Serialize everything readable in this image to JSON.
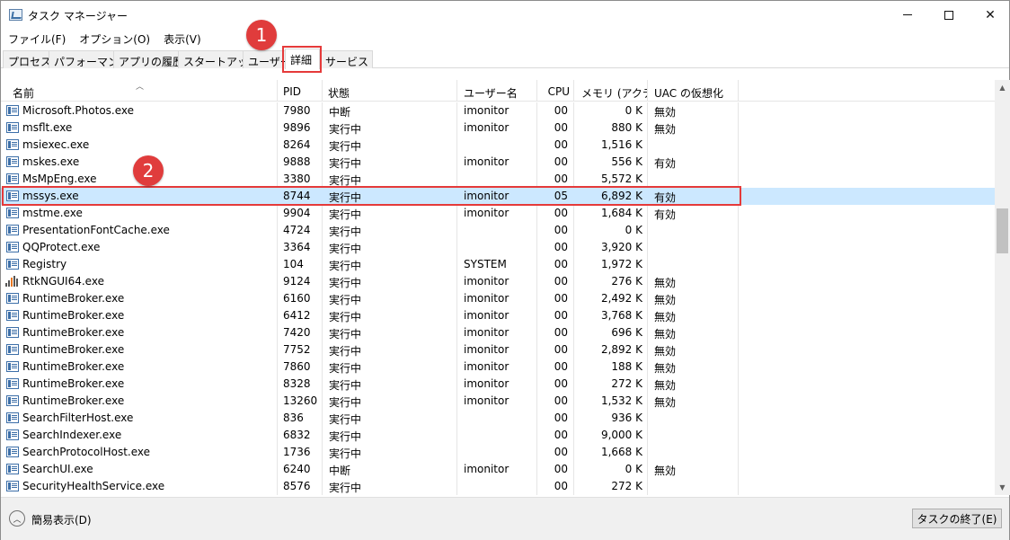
{
  "window": {
    "title": "タスク マネージャー",
    "accent_color": "#e03c3c",
    "selection_color": "#cce8ff"
  },
  "menu": [
    "ファイル(F)",
    "オプション(O)",
    "表示(V)"
  ],
  "tabs": [
    "プロセス",
    "パフォーマンス",
    "アプリの履歴",
    "スタートアップ",
    "ユーザー",
    "詳細",
    "サービス"
  ],
  "active_tab": "詳細",
  "badges": {
    "one": "1",
    "two": "2"
  },
  "columns": {
    "name": "名前",
    "pid": "PID",
    "status": "状態",
    "user": "ユーザー名",
    "cpu": "CPU",
    "memory": "メモリ (アクテ...",
    "uac": "UAC の仮想化"
  },
  "rows": [
    {
      "name": "Microsoft.Photos.exe",
      "pid": "7980",
      "status": "中断",
      "user": "imonitor",
      "cpu": "00",
      "memory": "0 K",
      "uac": "無効",
      "icon": "app-icon"
    },
    {
      "name": "msflt.exe",
      "pid": "9896",
      "status": "実行中",
      "user": "imonitor",
      "cpu": "00",
      "memory": "880 K",
      "uac": "無効",
      "icon": "app-icon"
    },
    {
      "name": "msiexec.exe",
      "pid": "8264",
      "status": "実行中",
      "user": "",
      "cpu": "00",
      "memory": "1,516 K",
      "uac": "",
      "icon": "app-icon"
    },
    {
      "name": "mskes.exe",
      "pid": "9888",
      "status": "実行中",
      "user": "imonitor",
      "cpu": "00",
      "memory": "556 K",
      "uac": "有効",
      "icon": "app-icon"
    },
    {
      "name": "MsMpEng.exe",
      "pid": "3380",
      "status": "実行中",
      "user": "",
      "cpu": "00",
      "memory": "5,572 K",
      "uac": "",
      "icon": "app-icon"
    },
    {
      "name": "mssys.exe",
      "pid": "8744",
      "status": "実行中",
      "user": "imonitor",
      "cpu": "05",
      "memory": "6,892 K",
      "uac": "有効",
      "icon": "app-icon",
      "selected": true
    },
    {
      "name": "mstme.exe",
      "pid": "9904",
      "status": "実行中",
      "user": "imonitor",
      "cpu": "00",
      "memory": "1,684 K",
      "uac": "有効",
      "icon": "app-icon"
    },
    {
      "name": "PresentationFontCache.exe",
      "pid": "4724",
      "status": "実行中",
      "user": "",
      "cpu": "00",
      "memory": "0 K",
      "uac": "",
      "icon": "app-icon"
    },
    {
      "name": "QQProtect.exe",
      "pid": "3364",
      "status": "実行中",
      "user": "",
      "cpu": "00",
      "memory": "3,920 K",
      "uac": "",
      "icon": "app-icon"
    },
    {
      "name": "Registry",
      "pid": "104",
      "status": "実行中",
      "user": "SYSTEM",
      "cpu": "00",
      "memory": "1,972 K",
      "uac": "",
      "icon": "app-icon"
    },
    {
      "name": "RtkNGUI64.exe",
      "pid": "9124",
      "status": "実行中",
      "user": "imonitor",
      "cpu": "00",
      "memory": "276 K",
      "uac": "無効",
      "icon": "speaker-icon"
    },
    {
      "name": "RuntimeBroker.exe",
      "pid": "6160",
      "status": "実行中",
      "user": "imonitor",
      "cpu": "00",
      "memory": "2,492 K",
      "uac": "無効",
      "icon": "app-icon"
    },
    {
      "name": "RuntimeBroker.exe",
      "pid": "6412",
      "status": "実行中",
      "user": "imonitor",
      "cpu": "00",
      "memory": "3,768 K",
      "uac": "無効",
      "icon": "app-icon"
    },
    {
      "name": "RuntimeBroker.exe",
      "pid": "7420",
      "status": "実行中",
      "user": "imonitor",
      "cpu": "00",
      "memory": "696 K",
      "uac": "無効",
      "icon": "app-icon"
    },
    {
      "name": "RuntimeBroker.exe",
      "pid": "7752",
      "status": "実行中",
      "user": "imonitor",
      "cpu": "00",
      "memory": "2,892 K",
      "uac": "無効",
      "icon": "app-icon"
    },
    {
      "name": "RuntimeBroker.exe",
      "pid": "7860",
      "status": "実行中",
      "user": "imonitor",
      "cpu": "00",
      "memory": "188 K",
      "uac": "無効",
      "icon": "app-icon"
    },
    {
      "name": "RuntimeBroker.exe",
      "pid": "8328",
      "status": "実行中",
      "user": "imonitor",
      "cpu": "00",
      "memory": "272 K",
      "uac": "無効",
      "icon": "app-icon"
    },
    {
      "name": "RuntimeBroker.exe",
      "pid": "13260",
      "status": "実行中",
      "user": "imonitor",
      "cpu": "00",
      "memory": "1,532 K",
      "uac": "無効",
      "icon": "app-icon"
    },
    {
      "name": "SearchFilterHost.exe",
      "pid": "836",
      "status": "実行中",
      "user": "",
      "cpu": "00",
      "memory": "936 K",
      "uac": "",
      "icon": "app-icon"
    },
    {
      "name": "SearchIndexer.exe",
      "pid": "6832",
      "status": "実行中",
      "user": "",
      "cpu": "00",
      "memory": "9,000 K",
      "uac": "",
      "icon": "app-icon"
    },
    {
      "name": "SearchProtocolHost.exe",
      "pid": "1736",
      "status": "実行中",
      "user": "",
      "cpu": "00",
      "memory": "1,668 K",
      "uac": "",
      "icon": "app-icon"
    },
    {
      "name": "SearchUI.exe",
      "pid": "6240",
      "status": "中断",
      "user": "imonitor",
      "cpu": "00",
      "memory": "0 K",
      "uac": "無効",
      "icon": "app-icon"
    },
    {
      "name": "SecurityHealthService.exe",
      "pid": "8576",
      "status": "実行中",
      "user": "",
      "cpu": "00",
      "memory": "272 K",
      "uac": "",
      "icon": "app-icon"
    }
  ],
  "footer": {
    "fewer_details": "簡易表示(D)",
    "end_task": "タスクの終了(E)"
  }
}
